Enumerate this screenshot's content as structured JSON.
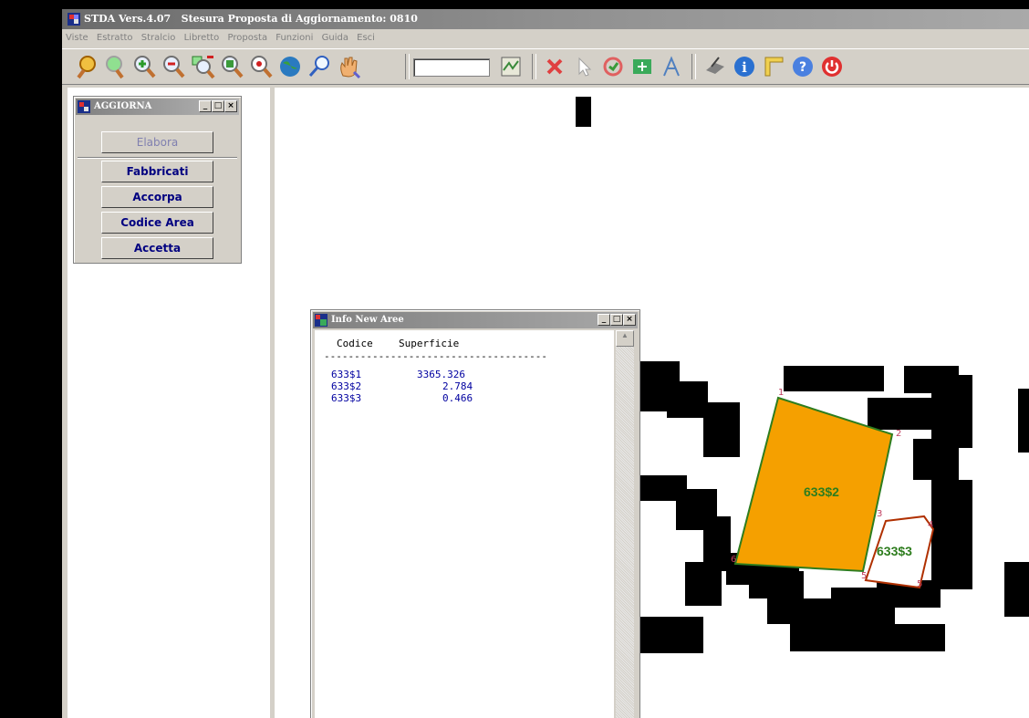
{
  "app": {
    "title": "STDA Vers.4.07   Stesura Proposta di Aggiornamento: 0810"
  },
  "menu": [
    "Viste",
    "Estratto",
    "Stralcio",
    "Libretto",
    "Proposta",
    "Funzioni",
    "Guida",
    "Esci"
  ],
  "toolbar": {
    "icons": [
      "zoom-prev-icon",
      "zoom-next-icon",
      "zoom-in-icon",
      "zoom-out-icon",
      "zoom-window-icon",
      "zoom-extent-icon",
      "zoom-center-icon",
      "globe-icon",
      "search-icon",
      "pan-hand-icon",
      "map-tile-icon",
      "delete-icon",
      "pointer-icon",
      "rotate-icon",
      "move-icon",
      "measure-icon",
      "print-icon",
      "info-icon",
      "ruler-icon",
      "help-icon",
      "power-icon"
    ],
    "scale_value": ""
  },
  "aggiorna_panel": {
    "title": "AGGIORNA",
    "buttons": [
      "Elabora",
      "Fabbricati",
      "Accorpa",
      "Codice Area",
      "Accetta"
    ]
  },
  "info_window": {
    "title": "Info New Aree",
    "col_codice": "Codice",
    "col_superficie": "Superficie",
    "rows": [
      {
        "codice": "633$1",
        "superficie": "3365.326"
      },
      {
        "codice": "633$2",
        "superficie": "2.784"
      },
      {
        "codice": "633$3",
        "superficie": "0.466"
      }
    ]
  },
  "map": {
    "parcel_labels": [
      "633$2",
      "633$3"
    ],
    "vertex_labels": [
      "1",
      "2",
      "3",
      "4",
      "5",
      "6",
      "5"
    ],
    "colors": {
      "parcel_fill": "#f5a000",
      "parcel_label": "#2e7d1e",
      "outline_red": "#b03000",
      "ink": "#000000"
    }
  }
}
